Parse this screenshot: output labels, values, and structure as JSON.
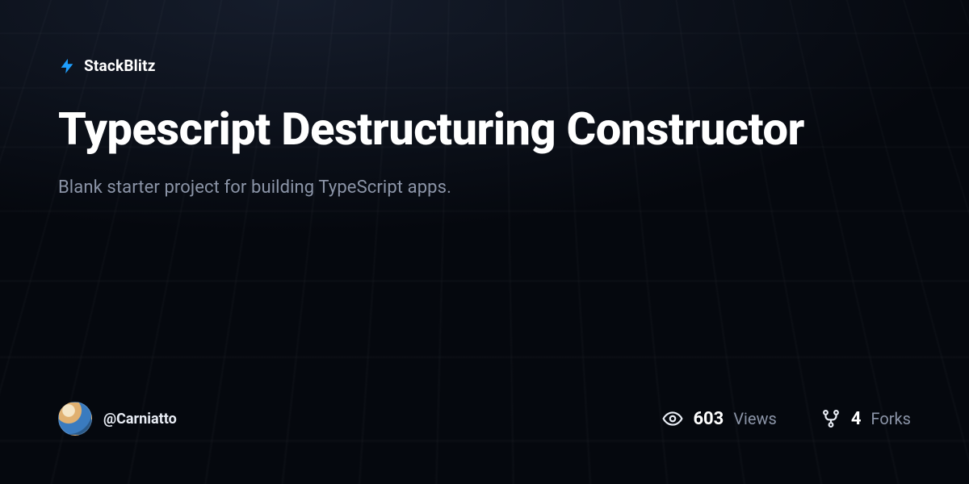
{
  "brand": {
    "name": "StackBlitz"
  },
  "project": {
    "title": "Typescript Destructuring Constructor",
    "description": "Blank starter project for building TypeScript apps."
  },
  "author": {
    "handle": "@Carniatto"
  },
  "stats": {
    "views": {
      "count": "603",
      "label": "Views"
    },
    "forks": {
      "count": "4",
      "label": "Forks"
    }
  }
}
